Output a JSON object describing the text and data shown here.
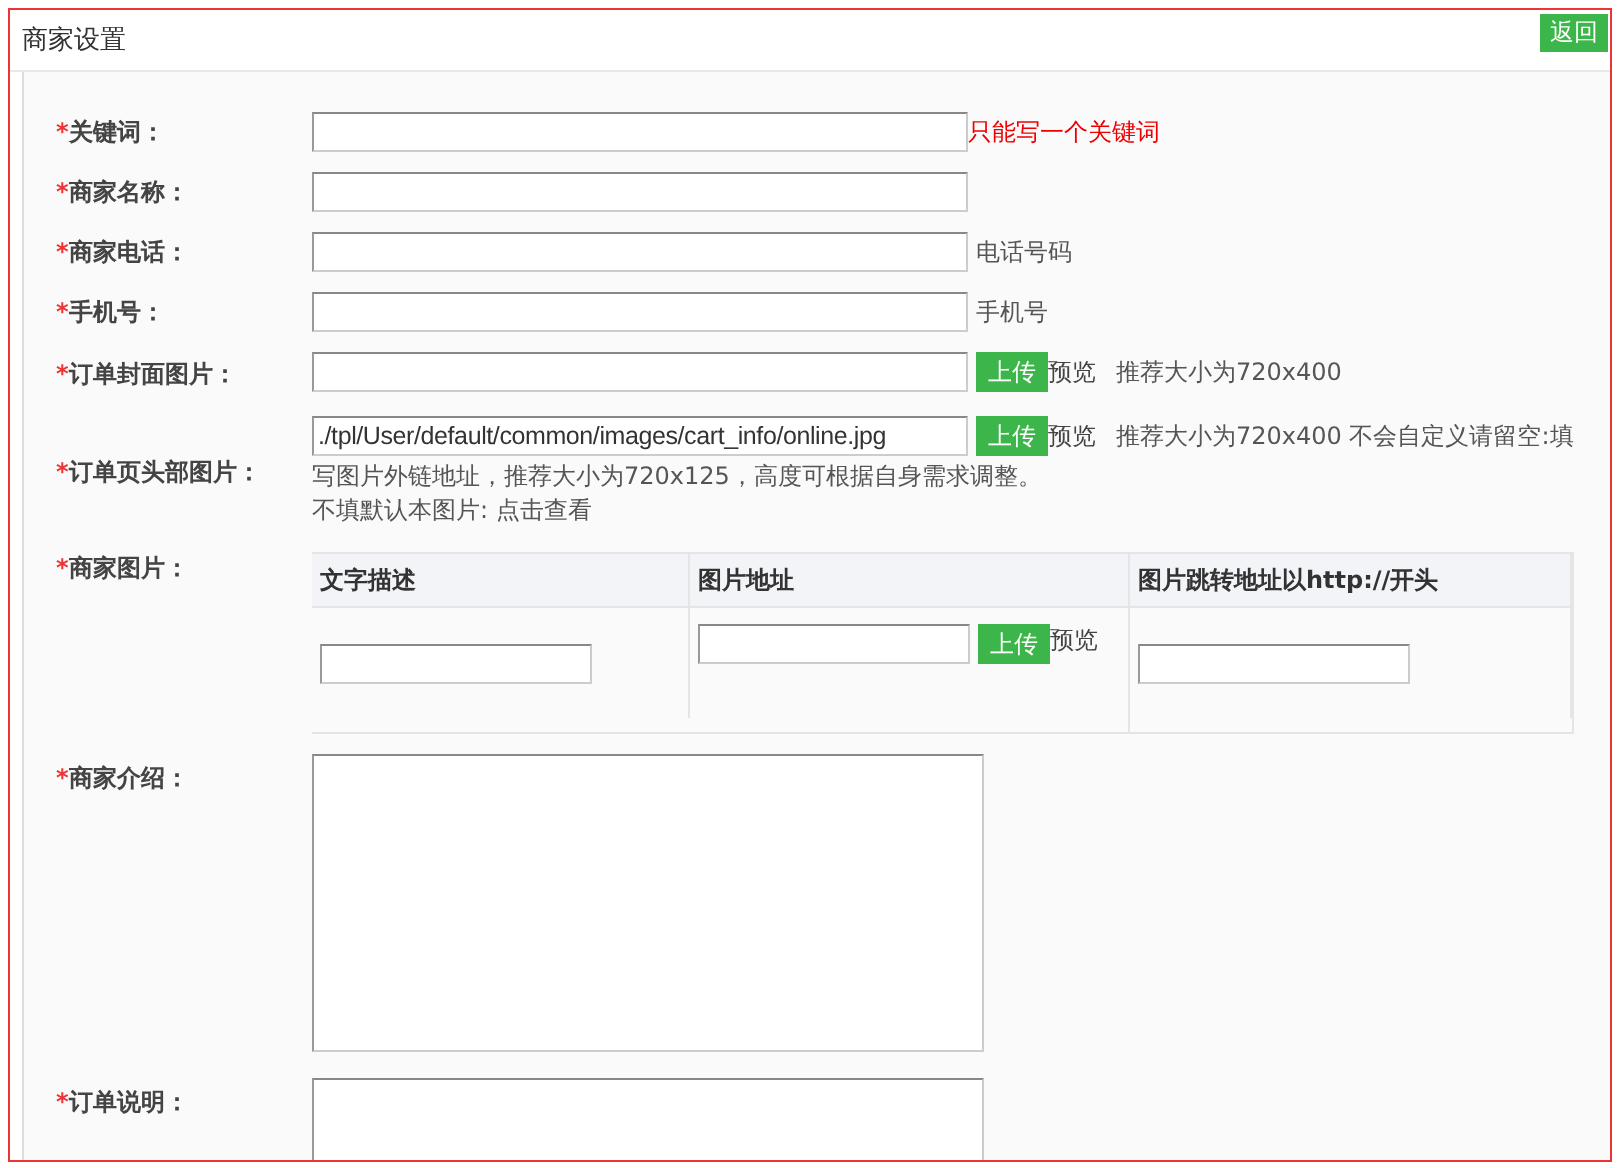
{
  "panel": {
    "title": "商家设置",
    "back_button": "返回"
  },
  "fields": [
    {
      "kind": "text",
      "mark": "*",
      "label": "关键词：",
      "note": "只能写一个关键词",
      "warning": true
    },
    {
      "kind": "text",
      "mark": "*",
      "label": "商家名称："
    },
    {
      "kind": "text",
      "mark": "*",
      "label": "商家电话：",
      "note": "电话号码",
      "warning": false
    },
    {
      "kind": "text",
      "mark": "*",
      "label": "手机号：",
      "note": "手机号",
      "warning": false
    },
    {
      "kind": "upload",
      "mark": "*",
      "label": "订单封面图片：",
      "upload_button": "上传",
      "preview": "预览",
      "note": "推荐大小为720x400"
    },
    {
      "kind": "upload",
      "mark": "*",
      "label": "订单页头部图片：",
      "value": "./tpl/User/default/common/images/cart_info/online.jpg",
      "upload_button": "上传",
      "preview": "预览",
      "note": "推荐大小为720x400 不会自定义请留空:填",
      "extra_lines": [
        "写图片外链地址，推荐大小为720x125，高度可根据自身需求调整。",
        "不填默认本图片: 点击查看"
      ]
    },
    {
      "kind": "table",
      "mark": "*",
      "label": "商家图片：",
      "columns": [
        "文字描述",
        "图片地址",
        "图片跳转地址以http://开头"
      ],
      "upload_button": "上传",
      "preview": "预览"
    },
    {
      "kind": "textarea",
      "mark": "*",
      "label": "商家介绍："
    },
    {
      "kind": "textarea",
      "mark": "*",
      "label": "订单说明："
    }
  ]
}
